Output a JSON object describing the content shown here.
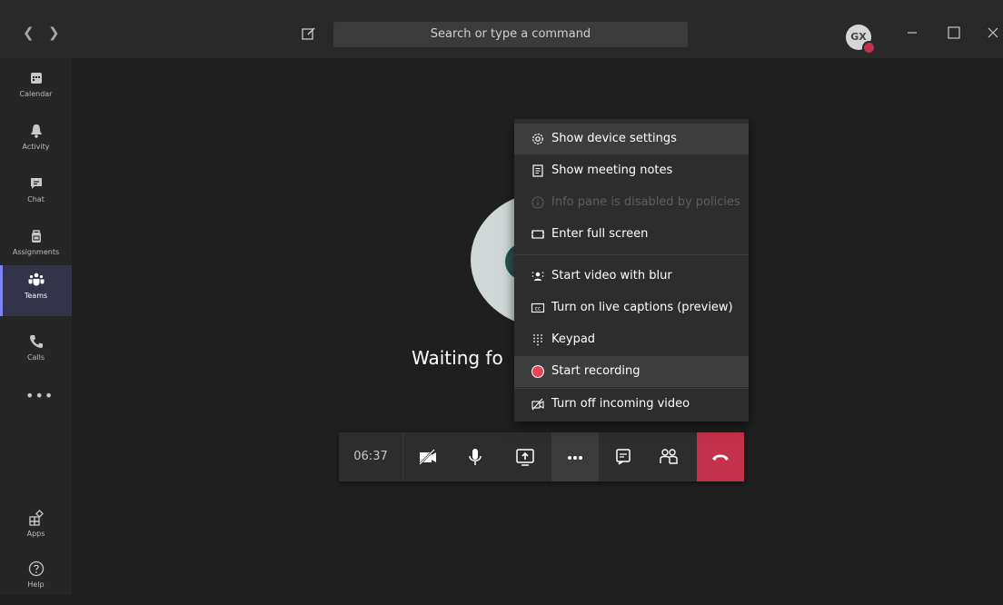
{
  "titlebar": {
    "search_placeholder": "Search or type a command",
    "avatar_initials": "GX",
    "back_icon": "chevron-left-icon",
    "forward_icon": "chevron-right-icon"
  },
  "sidebar": {
    "items": [
      {
        "label": "Calendar",
        "icon": "calendar-icon"
      },
      {
        "label": "Activity",
        "icon": "bell-icon"
      },
      {
        "label": "Chat",
        "icon": "chat-icon"
      },
      {
        "label": "Assignments",
        "icon": "backpack-icon"
      },
      {
        "label": "Teams",
        "icon": "teams-icon",
        "active": true
      },
      {
        "label": "Calls",
        "icon": "phone-icon"
      }
    ],
    "more_label": "•••",
    "bottom_items": [
      {
        "label": "Apps",
        "icon": "apps-icon"
      },
      {
        "label": "Help",
        "icon": "help-icon"
      }
    ]
  },
  "stage": {
    "waiting_text": "Waiting fo"
  },
  "callbar": {
    "timer": "06:37",
    "more_label": "•••"
  },
  "menu": {
    "items": [
      {
        "label": "Show device settings",
        "icon": "gear-icon"
      },
      {
        "label": "Show meeting notes",
        "icon": "notes-icon"
      },
      {
        "label": "Info pane is disabled by policies",
        "icon": "info-icon",
        "disabled": true
      },
      {
        "label": "Enter full screen",
        "icon": "fullscreen-icon"
      },
      {
        "label": "Start video with blur",
        "icon": "blur-icon"
      },
      {
        "label": "Turn on live captions (preview)",
        "icon": "captions-icon"
      },
      {
        "label": "Keypad",
        "icon": "keypad-icon"
      },
      {
        "label": "Start recording",
        "icon": "record-icon"
      },
      {
        "label": "Turn off incoming video",
        "icon": "video-off-icon"
      }
    ]
  },
  "colors": {
    "accent": "#7f85f5",
    "hangup": "#c4314b",
    "record": "#e8465f"
  }
}
